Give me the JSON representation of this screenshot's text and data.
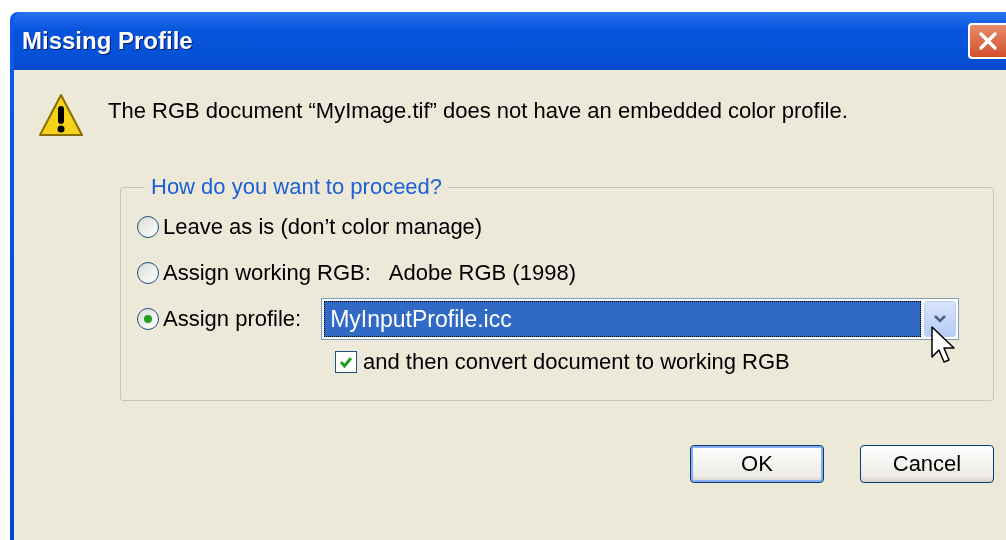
{
  "window": {
    "title": "Missing Profile"
  },
  "message": "The RGB document “MyImage.tif” does not have an embedded color profile.",
  "group": {
    "legend": "How do you want to proceed?",
    "options": [
      {
        "label": "Leave as is (don’t color manage)",
        "selected": false,
        "kind": "plain"
      },
      {
        "label": "Assign working RGB:",
        "detail": "Adobe RGB (1998)",
        "selected": false,
        "kind": "detail"
      },
      {
        "label": "Assign profile:",
        "selected": true,
        "kind": "select",
        "value": "MyInputProfile.icc"
      }
    ],
    "convert": {
      "label": "and then convert document to working RGB",
      "checked": true
    }
  },
  "buttons": [
    {
      "label": "OK",
      "default": true
    },
    {
      "label": "Cancel",
      "default": false
    }
  ]
}
